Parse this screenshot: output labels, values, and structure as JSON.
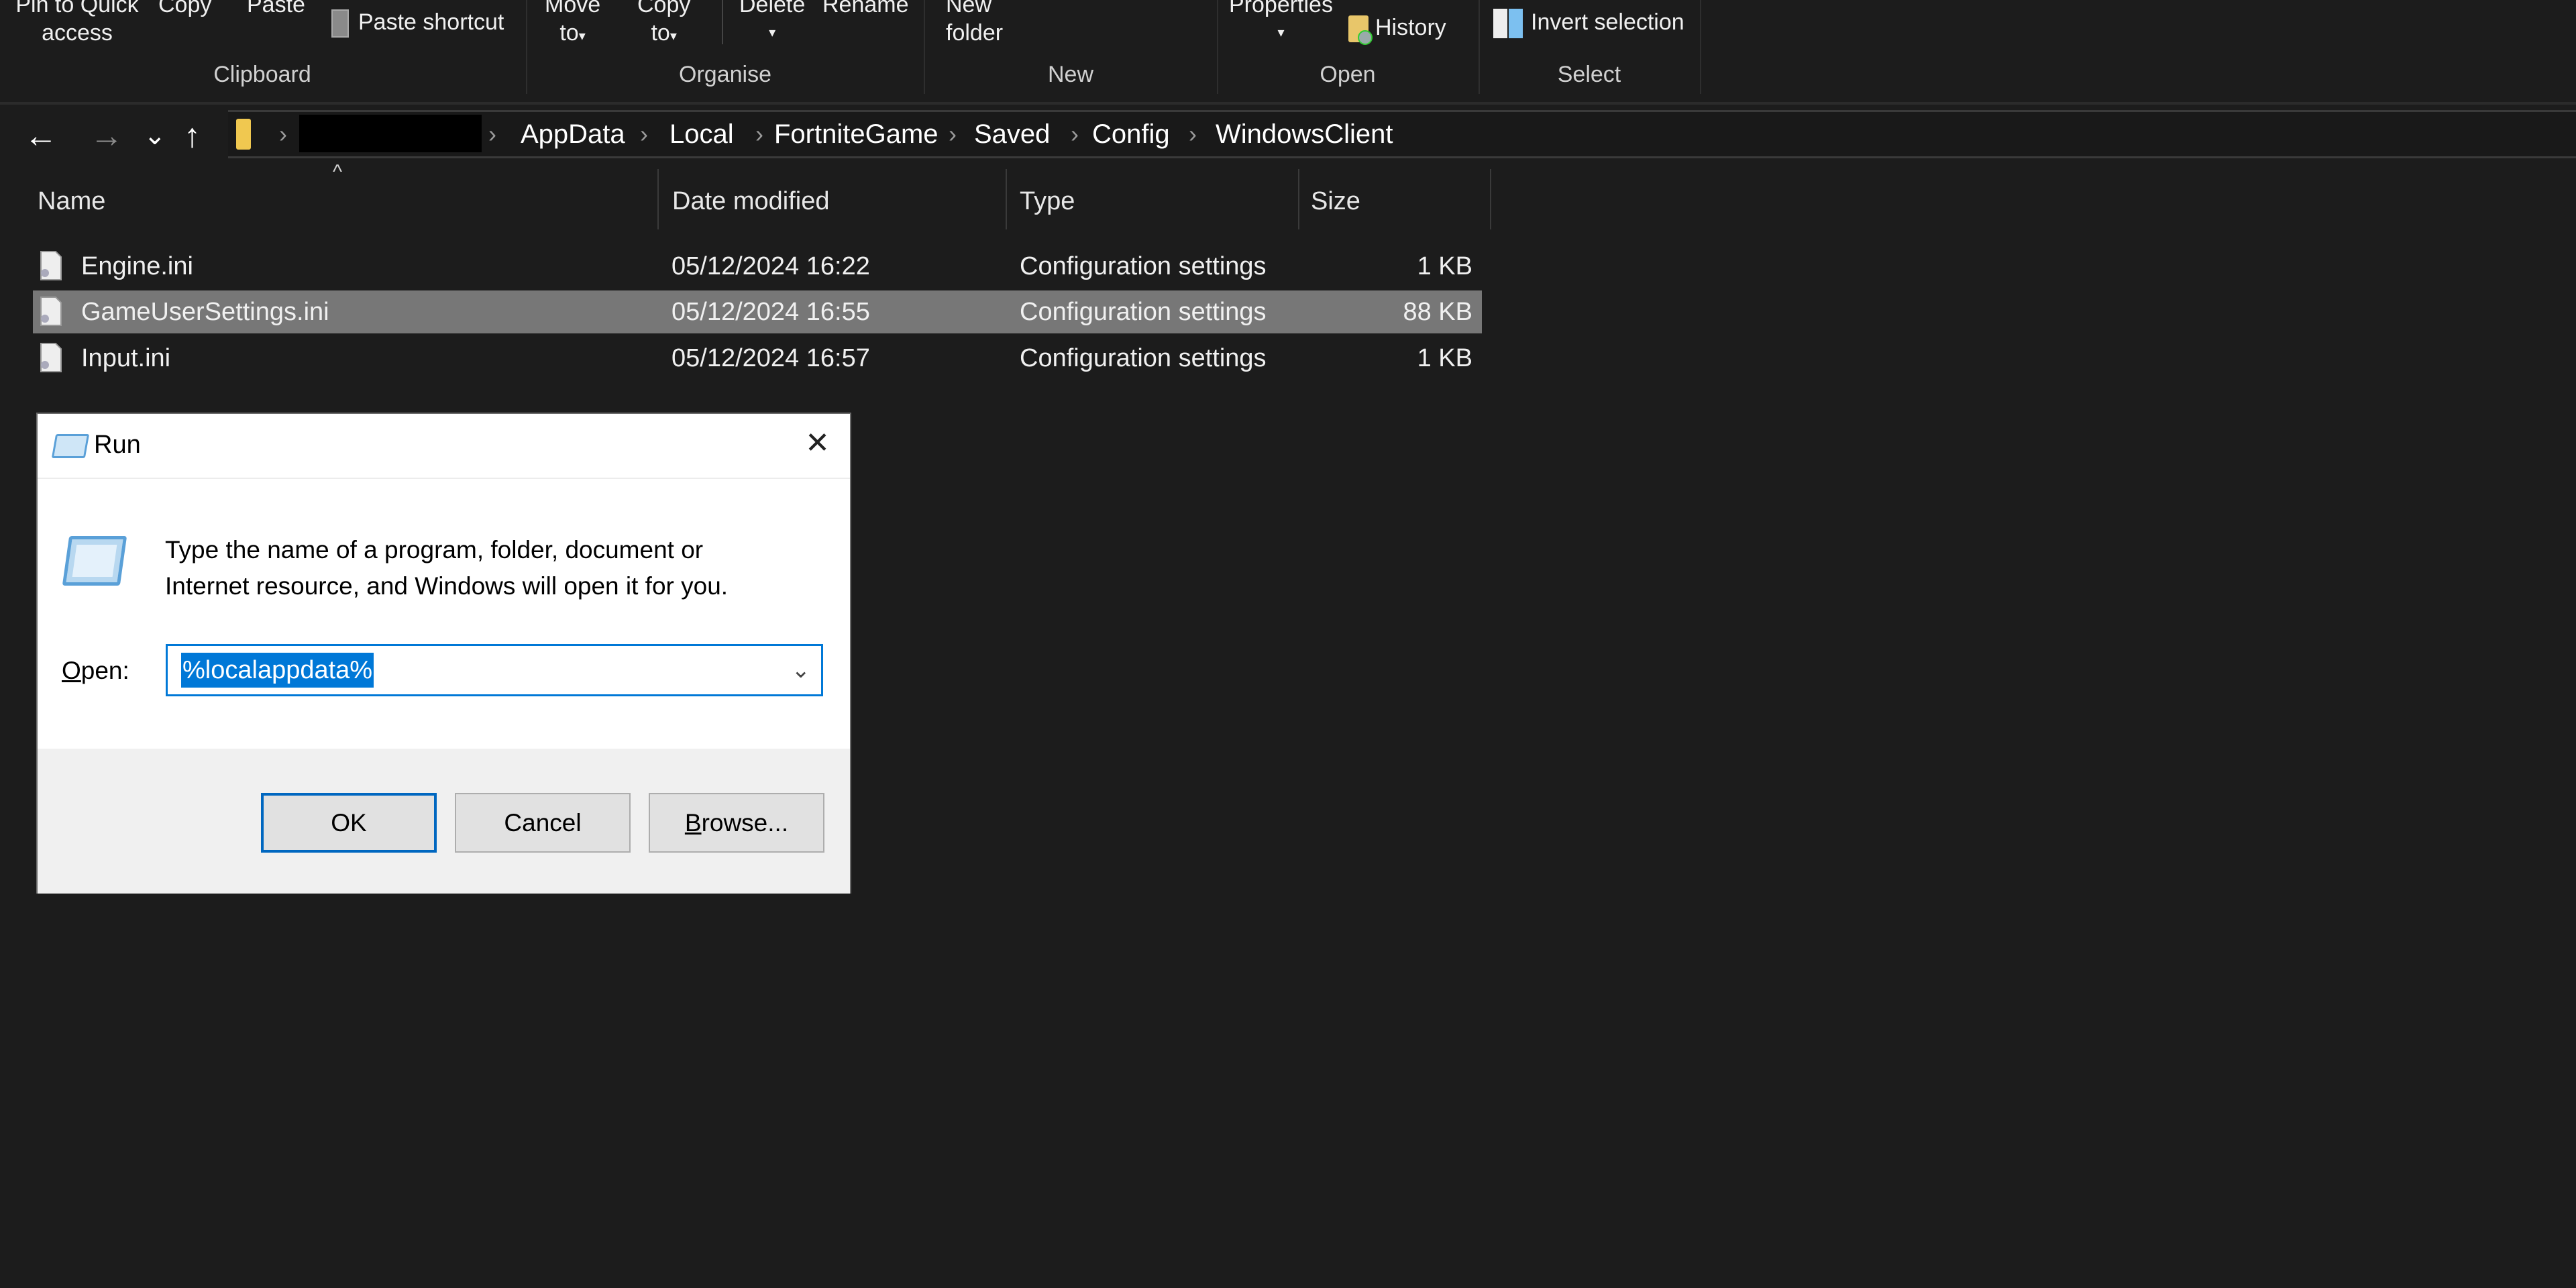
{
  "ribbon": {
    "clipboard": {
      "pin_line1": "Pin to Quick",
      "pin_line2": "access",
      "copy": "Copy",
      "paste": "Paste",
      "paste_shortcut": "Paste shortcut",
      "group_label": "Clipboard"
    },
    "organise": {
      "move_line1": "Move",
      "move_line2": "to",
      "copy_line1": "Copy",
      "copy_line2": "to",
      "delete": "Delete",
      "rename": "Rename",
      "group_label": "Organise"
    },
    "new": {
      "folder_line1": "New",
      "folder_line2": "folder",
      "group_label": "New"
    },
    "open": {
      "properties": "Properties",
      "history": "History",
      "group_label": "Open"
    },
    "select": {
      "invert": "Invert selection",
      "group_label": "Select"
    },
    "caret": "▾"
  },
  "nav": {
    "back": "←",
    "forward": "→",
    "recent": "⌄",
    "up": "↑",
    "sep": "›",
    "breadcrumb": [
      "AppData",
      "Local",
      "FortniteGame",
      "Saved",
      "Config",
      "WindowsClient"
    ]
  },
  "list": {
    "sort_indicator": "^",
    "columns": [
      "Name",
      "Date modified",
      "Type",
      "Size"
    ],
    "files": [
      {
        "name": "Engine.ini",
        "date": "05/12/2024 16:22",
        "type": "Configuration settings",
        "size": "1 KB",
        "selected": false
      },
      {
        "name": "GameUserSettings.ini",
        "date": "05/12/2024 16:55",
        "type": "Configuration settings",
        "size": "88 KB",
        "selected": true
      },
      {
        "name": "Input.ini",
        "date": "05/12/2024 16:57",
        "type": "Configuration settings",
        "size": "1 KB",
        "selected": false
      }
    ]
  },
  "run_dialog": {
    "title": "Run",
    "close": "✕",
    "description_line1": "Type the name of a program, folder, document or",
    "description_line2": "Internet resource, and Windows will open it for you.",
    "open_label_accel": "O",
    "open_label_rest": "pen:",
    "input_value": "%localappdata%",
    "dropdown": "⌄",
    "ok": "OK",
    "cancel": "Cancel",
    "browse_accel": "B",
    "browse_rest": "rowse..."
  },
  "colors": {
    "background": "#1c1c1c",
    "selected_row": "#777777",
    "accent": "#0078d7"
  }
}
